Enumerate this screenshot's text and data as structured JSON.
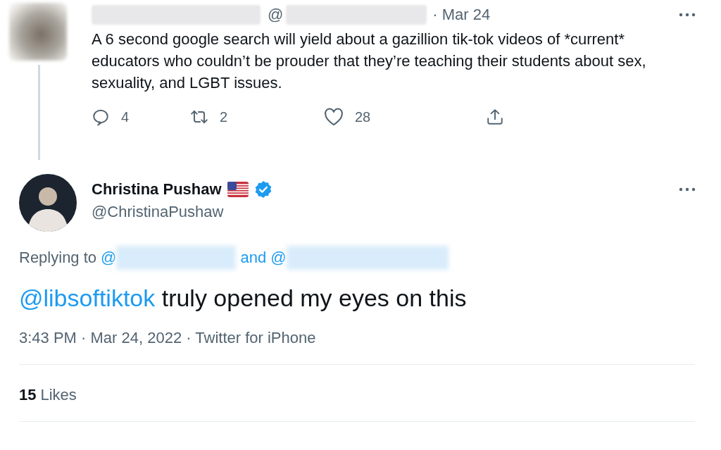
{
  "parent_tweet": {
    "at_sign": "@",
    "date": "· Mar 24",
    "text": "A 6 second google search will yield about a gazillion tik-tok videos of *current* educators who couldn’t be prouder that they’re teaching their students about sex, sexuality, and LGBT issues.",
    "actions": [
      {
        "kind": "reply",
        "count": "4"
      },
      {
        "kind": "retweet",
        "count": "2"
      },
      {
        "kind": "like",
        "count": "28"
      },
      {
        "kind": "share"
      }
    ]
  },
  "tweet": {
    "name": "Christina Pushaw",
    "handle": "@ChristinaPushaw",
    "replying_prefix": "Replying to",
    "replying_mentions": [
      "@",
      "and @"
    ],
    "mention": "@libsoftiktok",
    "text": " truly opened my eyes on this",
    "meta": "3:43 PM · Mar 24, 2022 · Twitter for iPhone",
    "likes_count": "15",
    "likes_label": "Likes"
  }
}
